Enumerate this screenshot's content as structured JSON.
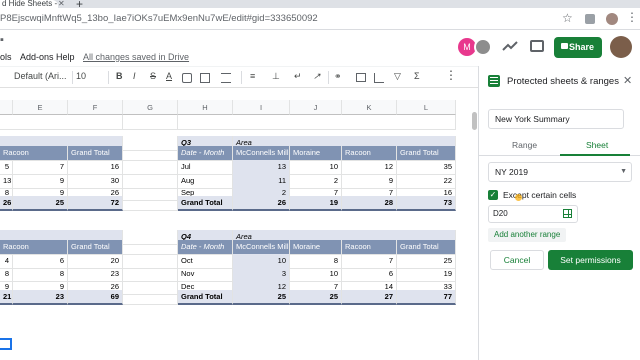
{
  "browser": {
    "tab_title": "d Hide Sheets - G",
    "url": "P8EjscwqiMnftWq5_13bo_Iae7iOKs7uEMx9enNu7wE/edit#gid=333650092"
  },
  "docs": {
    "menu": {
      "tools": "ols",
      "addons": "Add-ons",
      "help": "Help",
      "saved": "All changes saved in Drive"
    },
    "avatar_initial": "M",
    "share_label": "Share"
  },
  "toolbar": {
    "font": "Default (Ari...",
    "size": "10",
    "bold": "B",
    "italic": "I",
    "strike": "S",
    "text_color": "A",
    "halign": "≡",
    "valign": "⊥",
    "wrap": "↵",
    "rotate": "↗",
    "link": "⚭",
    "filter": "▽",
    "functions": "Σ",
    "more": "⋮"
  },
  "grid": {
    "columns": [
      "E",
      "F",
      "G",
      "H",
      "I",
      "J",
      "K",
      "L"
    ],
    "q3": {
      "label": "Q3",
      "area": "Area",
      "header_left": [
        "Racoon",
        "Grand Total"
      ],
      "header_right": [
        "Date - Month",
        "McConnells Mill",
        "Moraine",
        "Racoon",
        "Grand Total"
      ],
      "rows": [
        {
          "e": "5",
          "f": "7",
          "g": "16",
          "h": "Jul",
          "i": "13",
          "j": "10",
          "k": "12",
          "l": "35"
        },
        {
          "e": "13",
          "f": "9",
          "g": "30",
          "h": "Aug",
          "i": "11",
          "j": "2",
          "k": "9",
          "l": "22"
        },
        {
          "e": "8",
          "f": "9",
          "g": "26",
          "h": "Sep",
          "i": "2",
          "j": "7",
          "k": "7",
          "l": "16"
        }
      ],
      "total": {
        "e": "26",
        "f": "25",
        "g": "72",
        "h": "Grand Total",
        "i": "26",
        "j": "19",
        "k": "28",
        "l": "73"
      }
    },
    "q4": {
      "label": "Q4",
      "area": "Area",
      "header_left": [
        "Racoon",
        "Grand Total"
      ],
      "header_right": [
        "Date - Month",
        "McConnells Mill",
        "Moraine",
        "Racoon",
        "Grand Total"
      ],
      "rows": [
        {
          "e": "4",
          "f": "6",
          "g": "20",
          "h": "Oct",
          "i": "10",
          "j": "8",
          "k": "7",
          "l": "25"
        },
        {
          "e": "8",
          "f": "8",
          "g": "23",
          "h": "Nov",
          "i": "3",
          "j": "10",
          "k": "6",
          "l": "19"
        },
        {
          "e": "9",
          "f": "9",
          "g": "26",
          "h": "Dec",
          "i": "12",
          "j": "7",
          "k": "14",
          "l": "33"
        }
      ],
      "total": {
        "e": "21",
        "f": "23",
        "g": "69",
        "h": "Grand Total",
        "i": "25",
        "j": "25",
        "k": "27",
        "l": "77"
      }
    }
  },
  "panel": {
    "title": "Protected sheets & ranges",
    "description": "New York Summary",
    "tab_range": "Range",
    "tab_sheet": "Sheet",
    "sheet_selected": "NY 2019",
    "except_label": "Except certain cells",
    "range_value": "D20",
    "add_range": "Add another range",
    "cancel": "Cancel",
    "set_permissions": "Set permissions"
  }
}
